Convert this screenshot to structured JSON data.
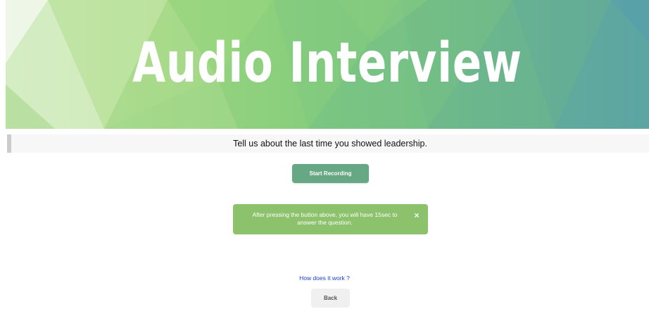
{
  "banner": {
    "title": "Audio Interview"
  },
  "question": {
    "text": "Tell us about the last time you showed leadership."
  },
  "controls": {
    "start_label": "Start Recording",
    "back_label": "Back"
  },
  "alert": {
    "text": "After pressing the button above, you will have 15sec to answer the question.",
    "close_glyph": "×",
    "close_icon": "close-icon"
  },
  "help": {
    "link_label": "How does it work ?"
  },
  "colors": {
    "start_button": "#66a884",
    "alert_background": "#8dc26c",
    "link": "#1a3fd6",
    "question_bar": "#f7f7f7",
    "back_button": "#f0f0f0"
  }
}
